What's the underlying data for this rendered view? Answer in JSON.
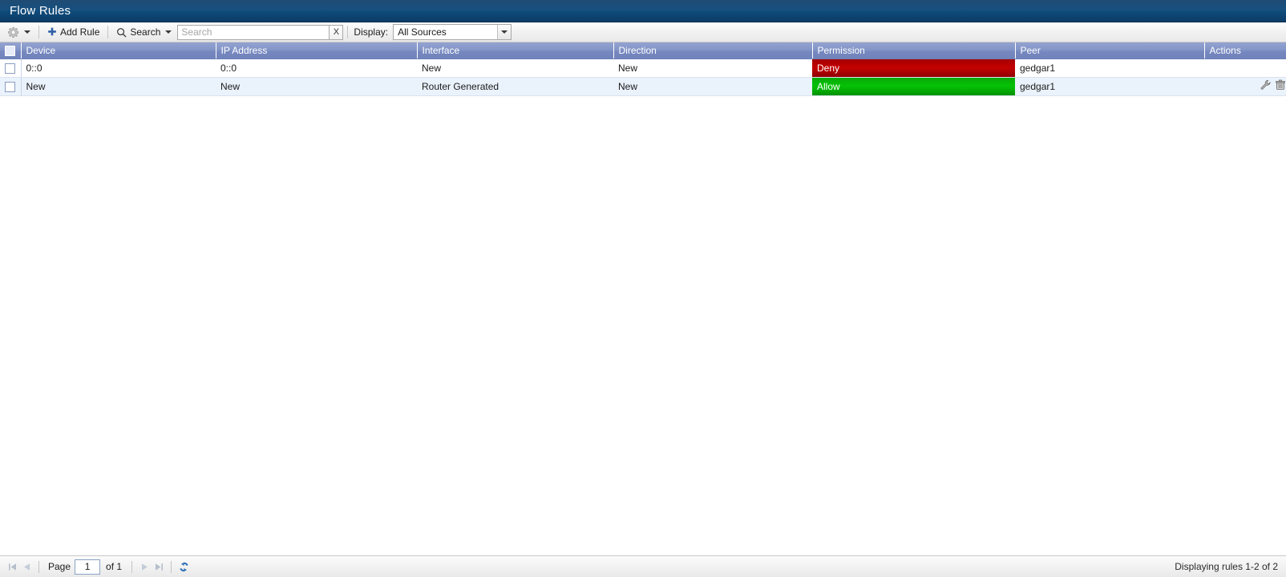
{
  "window": {
    "title": "Flow Rules"
  },
  "toolbar": {
    "gear_icon": "gear-icon",
    "gear_caret_icon": "chevron-down-icon",
    "add_rule_label": "Add Rule",
    "add_rule_icon": "plus-icon",
    "search_menu_label": "Search",
    "search_menu_icon": "magnifier-icon",
    "search_placeholder": "Search",
    "search_value": "",
    "search_clear_label": "X",
    "display_label": "Display:",
    "display_selected": "All Sources",
    "display_options": [
      "All Sources"
    ]
  },
  "grid": {
    "select_all_checkbox": false,
    "columns": [
      {
        "key": "device",
        "label": "Device"
      },
      {
        "key": "ip",
        "label": "IP Address"
      },
      {
        "key": "interface",
        "label": "Interface"
      },
      {
        "key": "direction",
        "label": "Direction"
      },
      {
        "key": "permission",
        "label": "Permission"
      },
      {
        "key": "peer",
        "label": "Peer"
      },
      {
        "key": "actions",
        "label": "Actions"
      }
    ],
    "rows": [
      {
        "device": "0::0",
        "ip": "0::0",
        "interface": "New",
        "direction": "New",
        "permission": "Deny",
        "permission_state": "deny",
        "peer": "gedgar1",
        "actions": []
      },
      {
        "device": "New",
        "ip": "New",
        "interface": "Router Generated",
        "direction": "New",
        "permission": "Allow",
        "permission_state": "allow",
        "peer": "gedgar1",
        "actions": [
          "edit-wrench-icon",
          "delete-trash-icon"
        ]
      }
    ]
  },
  "pager": {
    "first_icon": "first-page-icon",
    "prev_icon": "previous-page-icon",
    "page_label": "Page",
    "page_value": "1",
    "of_label": "of 1",
    "next_icon": "next-page-icon",
    "last_icon": "last-page-icon",
    "refresh_icon": "refresh-icon",
    "status": "Displaying rules 1-2 of 2"
  },
  "colors": {
    "titlebar": "#134b7a",
    "header": "#7d8fc4",
    "deny": "#b80202",
    "allow": "#06b806",
    "row_alt": "#eaf2fb"
  }
}
